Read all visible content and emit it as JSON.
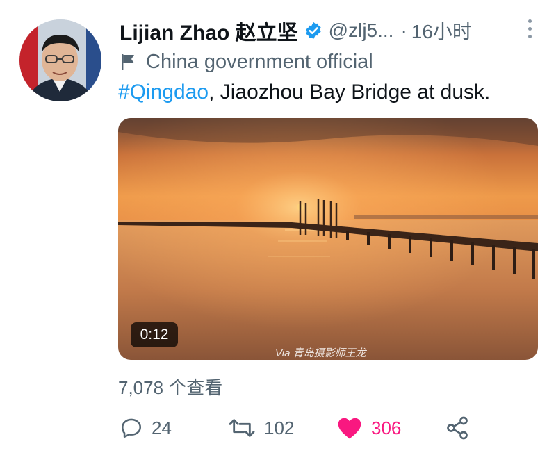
{
  "author": {
    "name": "Lijian Zhao 赵立坚",
    "handle": "@zlj5...",
    "time_separator": "·",
    "time": "16小时",
    "label": "China government official"
  },
  "tweet": {
    "hashtag": "#Qingdao",
    "text": ", Jiaozhou Bay Bridge at dusk."
  },
  "media": {
    "duration": "0:12",
    "watermark": "Via 青岛摄影师王龙"
  },
  "views": "7,078 个查看",
  "actions": {
    "reply_count": "24",
    "retweet_count": "102",
    "like_count": "306"
  },
  "colors": {
    "link": "#1d9bf0",
    "like": "#f91880",
    "secondary_text": "#536471"
  }
}
